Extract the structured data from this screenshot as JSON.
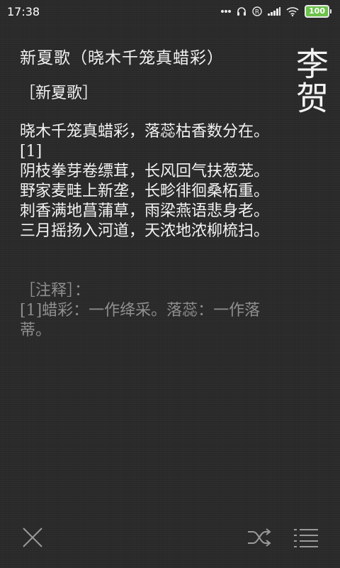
{
  "status_bar": {
    "time": "17:38",
    "battery_level": "100",
    "icons": [
      "dots-icon",
      "headphones-icon",
      "registered-icon",
      "signal-icon",
      "wifi-icon",
      "battery-icon"
    ]
  },
  "poem": {
    "title": "新夏歌（晓木千笼真蜡彩）",
    "heading": "［新夏歌］",
    "lines": [
      "晓木千笼真蜡彩，落蕊枯香数分在。[1]",
      "阴枝拳芽卷缥茸，长风回气扶葱茏。",
      "野家麦畦上新垄，长畛徘徊桑柘重。",
      "刺香满地菖蒲草，雨梁燕语悲身老。",
      "三月摇扬入河道，天浓地浓柳梳扫。"
    ],
    "notes_heading": "［注释］：",
    "notes": [
      "[1]蜡彩：一作绛采。落蕊：一作落蒂。"
    ]
  },
  "author": "李贺",
  "toolbar": {
    "close_icon": "close-icon",
    "shuffle_icon": "shuffle-icon",
    "list_icon": "list-icon"
  },
  "colors": {
    "background": "#2a2a2a",
    "text": "#f2f2f2",
    "notes": "#8f8f8f",
    "battery": "#6cc24a",
    "icon": "#9a9a9a"
  }
}
